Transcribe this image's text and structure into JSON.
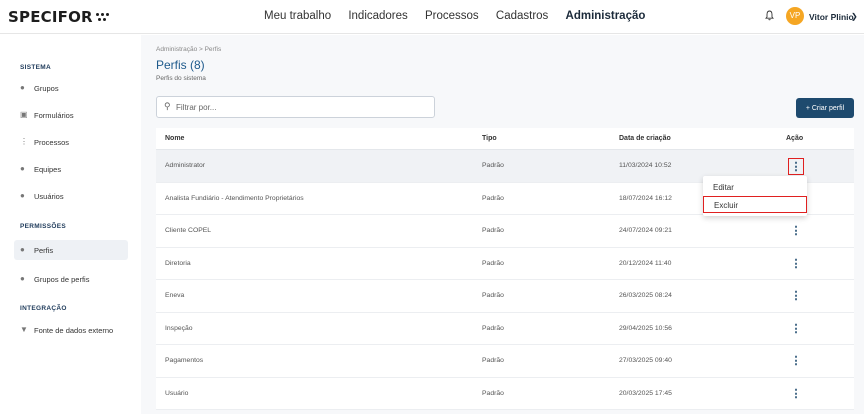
{
  "header": {
    "logo_text": "SPECIFOR",
    "nav": [
      "Meu trabalho",
      "Indicadores",
      "Processos",
      "Cadastros",
      "Administração"
    ],
    "active_nav_index": 4,
    "avatar_initials": "VP",
    "user_name": "Vitor Plinio",
    "accent_color": "#f5a623"
  },
  "sidebar": {
    "sections": [
      {
        "title": "SISTEMA",
        "items": [
          {
            "label": "Grupos",
            "icon": "tag-icon"
          },
          {
            "label": "Formulários",
            "icon": "clipboard-icon"
          },
          {
            "label": "Processos",
            "icon": "flow-icon"
          },
          {
            "label": "Equipes",
            "icon": "team-icon"
          },
          {
            "label": "Usuários",
            "icon": "user-icon"
          }
        ]
      },
      {
        "title": "PERMISSÕES",
        "items": [
          {
            "label": "Perfis",
            "icon": "profile-settings-icon",
            "active": true
          },
          {
            "label": "Grupos de perfis",
            "icon": "profile-group-icon"
          }
        ]
      },
      {
        "title": "INTEGRAÇÃO",
        "items": [
          {
            "label": "Fonte de dados externo",
            "icon": "plug-icon"
          }
        ]
      }
    ]
  },
  "main": {
    "breadcrumb": "Administração  >  Perfis",
    "title": "Perfis (8)",
    "subtitle": "Perfis do sistema",
    "filter_placeholder": "Filtrar por...",
    "create_button": "+ Criar perfil",
    "primary_color": "#1e4a6e",
    "table": {
      "columns": [
        "Nome",
        "Tipo",
        "Data de criação",
        "Ação"
      ],
      "rows": [
        {
          "nome": "Administrator",
          "tipo": "Padrão",
          "data": "11/03/2024 10:52"
        },
        {
          "nome": "Analista Fundiário - Atendimento Proprietários",
          "tipo": "Padrão",
          "data": "18/07/2024 16:12"
        },
        {
          "nome": "Cliente COPEL",
          "tipo": "Padrão",
          "data": "24/07/2024 09:21"
        },
        {
          "nome": "Diretoria",
          "tipo": "Padrão",
          "data": "20/12/2024 11:40"
        },
        {
          "nome": "Eneva",
          "tipo": "Padrão",
          "data": "26/03/2025 08:24"
        },
        {
          "nome": "Inspeção",
          "tipo": "Padrão",
          "data": "29/04/2025 10:56"
        },
        {
          "nome": "Pagamentos",
          "tipo": "Padrão",
          "data": "27/03/2025 09:40"
        },
        {
          "nome": "Usuário",
          "tipo": "Padrão",
          "data": "20/03/2025 17:45"
        }
      ]
    },
    "action_menu": {
      "open_row_index": 0,
      "items": [
        "Editar",
        "Excluir"
      ],
      "highlighted_item_index": 1
    },
    "kebab_glyph": "⋮"
  }
}
